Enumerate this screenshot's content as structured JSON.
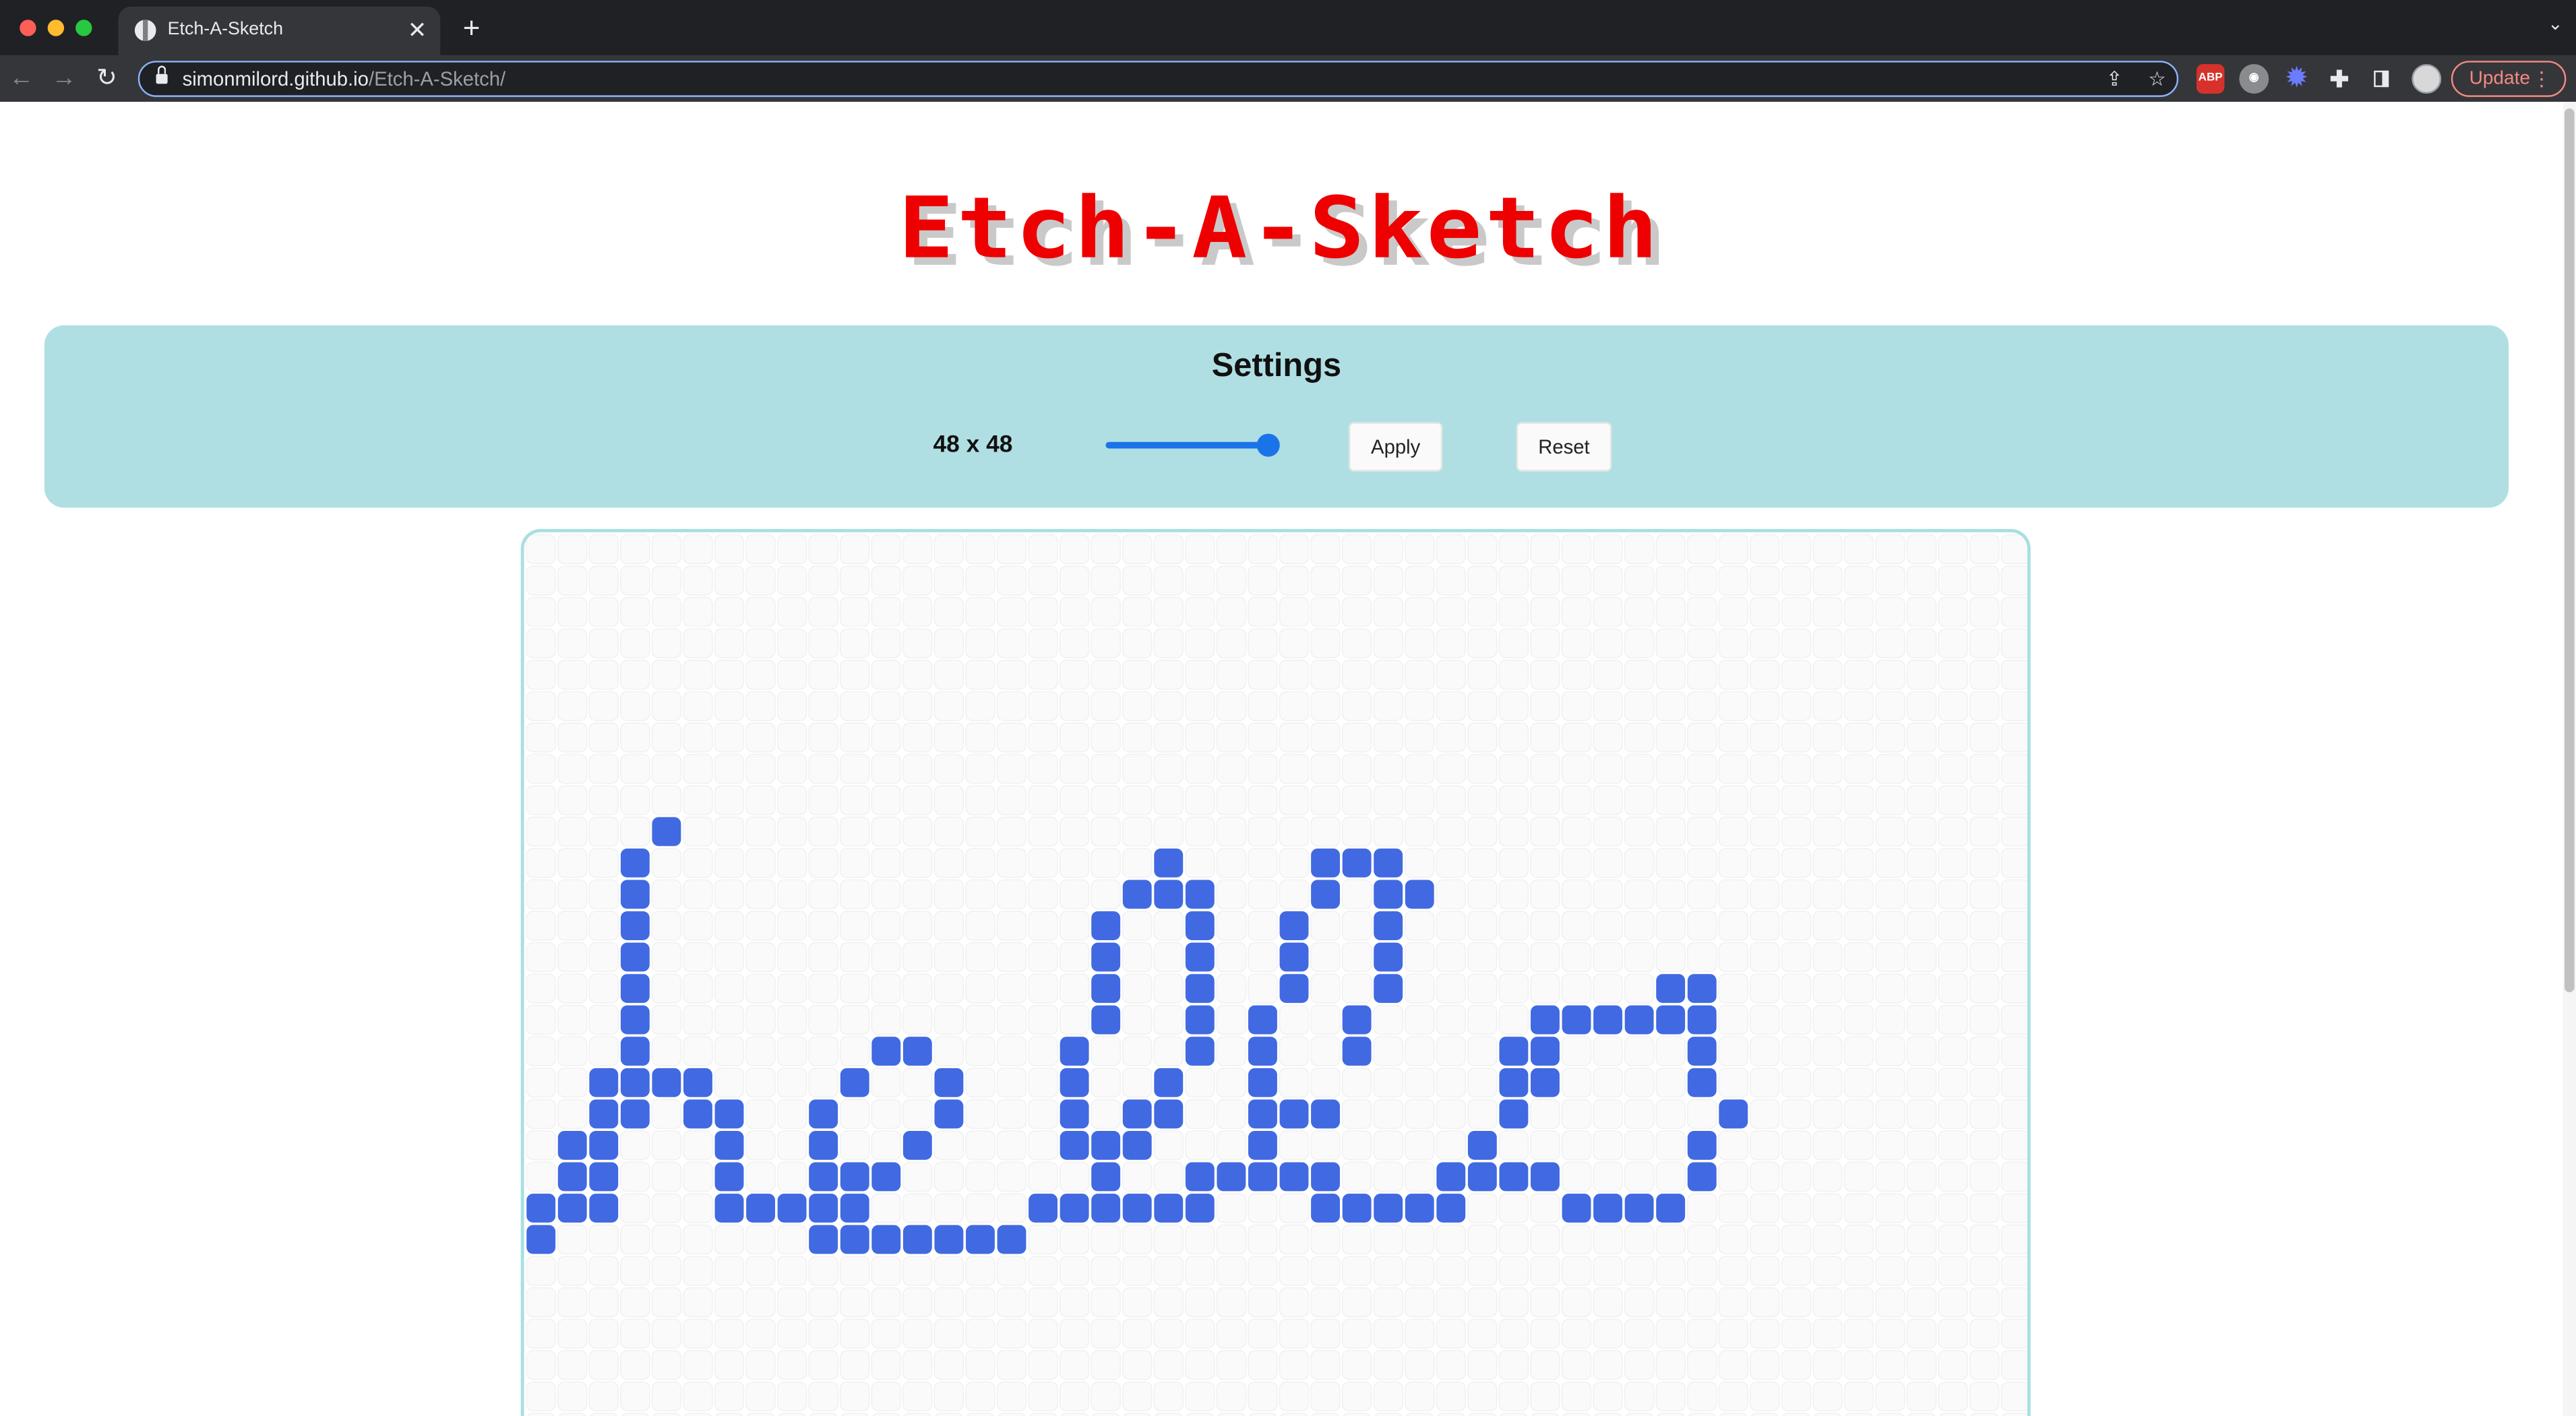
{
  "browser": {
    "tab_title": "Etch-A-Sketch",
    "tab_close": "✕",
    "new_tab": "+",
    "url_host": "simonmilord.github.io",
    "url_path": "/Etch-A-Sketch/",
    "update_label": "Update",
    "menu_dots": "⋮",
    "ext_abp": "ABP",
    "colors": {
      "window_close": "#ff5f57",
      "window_min": "#febc2e",
      "window_max": "#28c840"
    }
  },
  "page": {
    "title": "Etch-A-Sketch",
    "settings": {
      "heading": "Settings",
      "grid_size_label": "48 x 48",
      "slider_value": 48,
      "slider_fraction": 1.0,
      "apply_label": "Apply",
      "reset_label": "Reset"
    },
    "board": {
      "grid_size": 48,
      "ink_color": "#4169e1",
      "empty_color": "#fafafa",
      "drawing_text": "hello",
      "filled_cells": [
        "r9c4",
        "r10c3",
        "r11c3",
        "r12c3",
        "r13c3",
        "r14c3",
        "r15c3",
        "r16c3",
        "r17c2",
        "r17c3",
        "r17c4",
        "r17c5",
        "r18c2",
        "r18c3",
        "r18c5",
        "r18c6",
        "r19c1",
        "r19c2",
        "r19c6",
        "r20c1",
        "r20c2",
        "r20c6",
        "r21c0",
        "r21c1",
        "r21c2",
        "r21c6",
        "r21c7",
        "r21c8",
        "r21c9",
        "r22c0",
        "r16c11",
        "r16c12",
        "r17c10",
        "r17c13",
        "r18c9",
        "r18c13",
        "r19c9",
        "r19c12",
        "r20c9",
        "r20c10",
        "r20c11",
        "r21c9",
        "r21c10",
        "r22c9",
        "r22c10",
        "r22c11",
        "r22c12",
        "r22c13",
        "r22c14",
        "r22c15",
        "r10c20",
        "r11c19",
        "r11c20",
        "r11c21",
        "r12c18",
        "r12c21",
        "r13c18",
        "r13c21",
        "r14c18",
        "r14c21",
        "r15c18",
        "r15c21",
        "r16c17",
        "r16c21",
        "r17c17",
        "r17c20",
        "r18c17",
        "r18c19",
        "r18c20",
        "r19c17",
        "r19c18",
        "r19c19",
        "r20c18",
        "r21c16",
        "r21c17",
        "r21c18",
        "r21c19",
        "r21c20",
        "r21c21",
        "r20c21",
        "r20c22",
        "r20c23",
        "r20c24",
        "r20c25",
        "r10c25",
        "r10c26",
        "r10c27",
        "r11c25",
        "r11c27",
        "r11c28",
        "r12c24",
        "r12c27",
        "r13c24",
        "r13c27",
        "r14c24",
        "r14c27",
        "r15c23",
        "r15c26",
        "r16c23",
        "r16c26",
        "r17c23",
        "r18c23",
        "r18c24",
        "r18c25",
        "r19c23",
        "r20c24",
        "r21c25",
        "r21c26",
        "r21c27",
        "r21c28",
        "r21c29",
        "r20c29",
        "r20c30",
        "r20c31",
        "r19c30",
        "r18c31",
        "r17c31",
        "r17c32",
        "r16c31",
        "r16c32",
        "r15c32",
        "r15c33",
        "r15c34",
        "r15c35",
        "r15c36",
        "r15c37",
        "r14c36",
        "r14c37",
        "r16c37",
        "r17c37",
        "r18c38",
        "r19c37",
        "r20c37",
        "r20c32",
        "r21c33",
        "r21c34",
        "r21c35",
        "r21c36"
      ]
    }
  }
}
